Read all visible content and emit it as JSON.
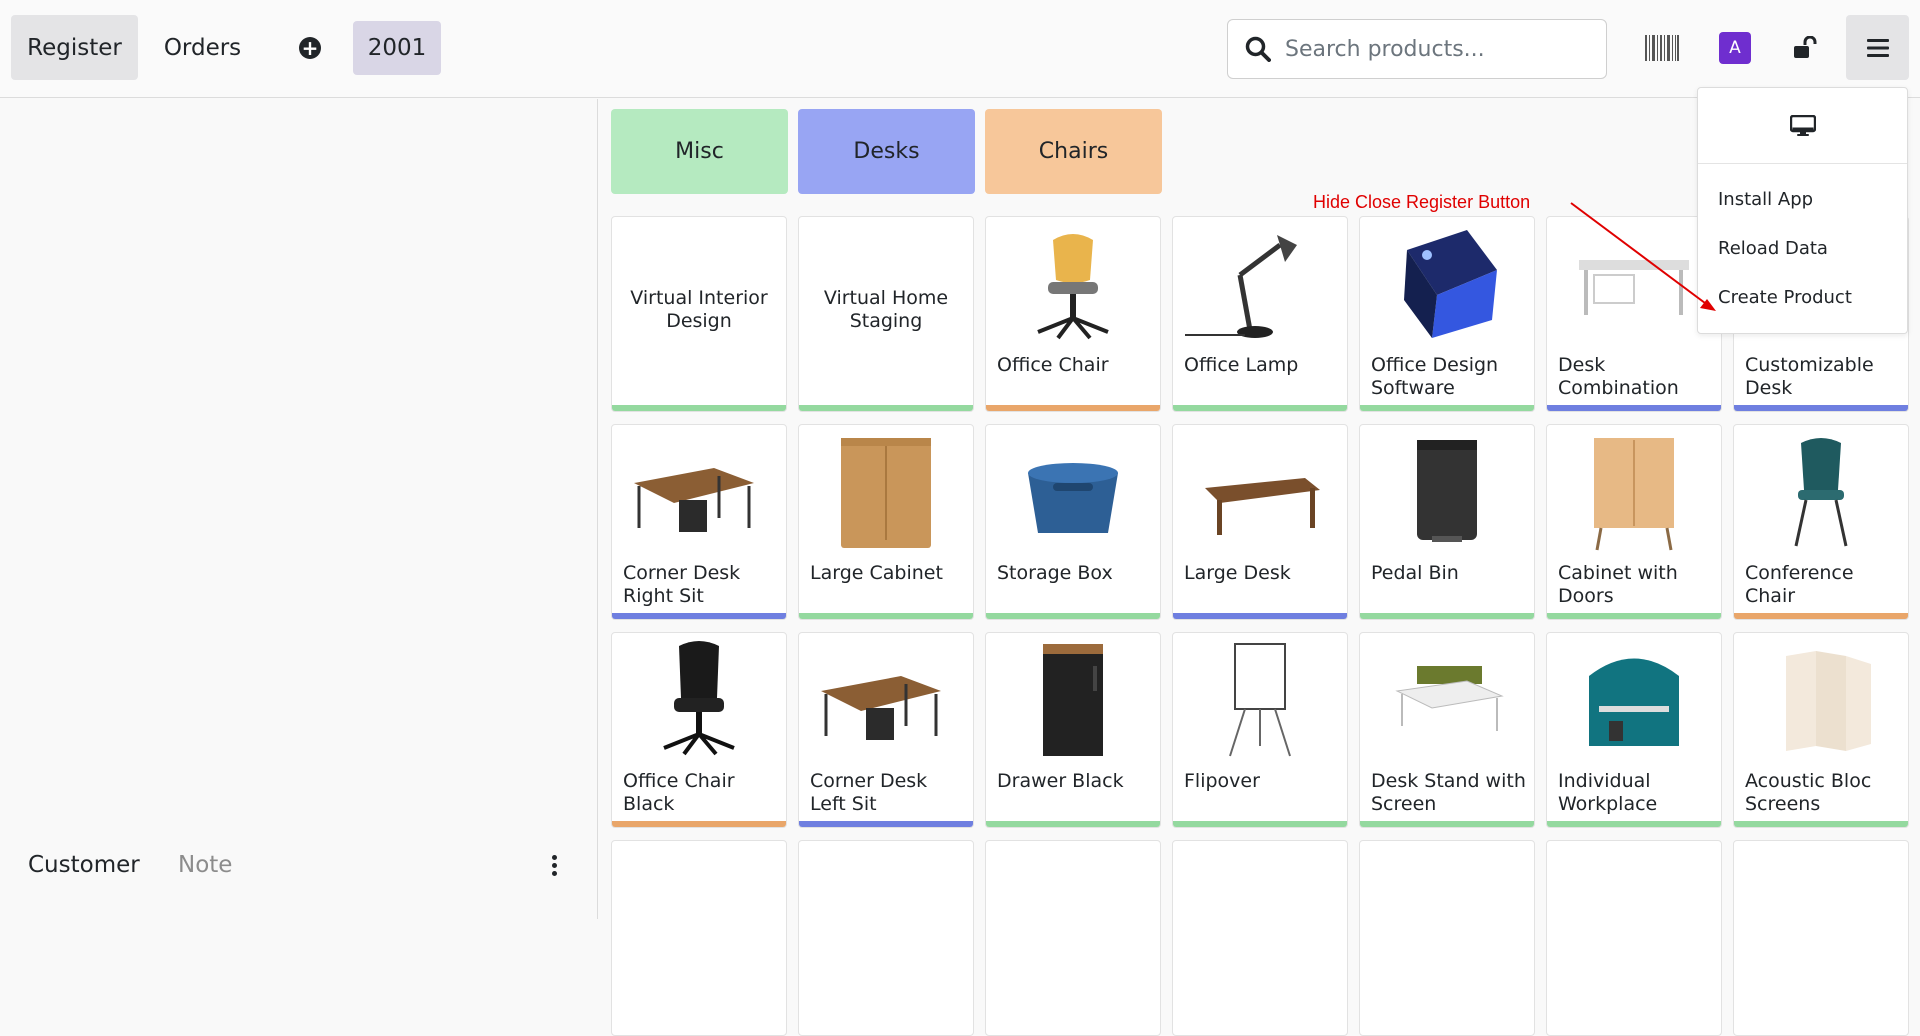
{
  "header": {
    "register_label": "Register",
    "orders_label": "Orders",
    "order_number": "2001",
    "search_placeholder": "Search products...",
    "avatar_letter": "A",
    "icons": {
      "plus": "plus-circle-icon",
      "search": "search-icon",
      "barcode": "barcode-icon",
      "lock": "unlock-icon",
      "menu": "hamburger-icon"
    }
  },
  "left_panel": {
    "customer_label": "Customer",
    "note_label": "Note"
  },
  "categories": [
    {
      "label": "Misc",
      "color": "#b5eac0"
    },
    {
      "label": "Desks",
      "color": "#98a5f3"
    },
    {
      "label": "Chairs",
      "color": "#f7c79a"
    }
  ],
  "products": [
    {
      "name": "Virtual Interior Design",
      "category": "Misc",
      "image": "none"
    },
    {
      "name": "Virtual Home Staging",
      "category": "Misc",
      "image": "none"
    },
    {
      "name": "Office Chair",
      "category": "Chairs",
      "image": "office-chair"
    },
    {
      "name": "Office Lamp",
      "category": "Misc",
      "image": "lamp"
    },
    {
      "name": "Office Design Software",
      "category": "Misc",
      "image": "software-box"
    },
    {
      "name": "Desk Combination",
      "category": "Desks",
      "image": "desk-combination"
    },
    {
      "name": "Customizable Desk",
      "category": "Desks",
      "image": "desk"
    },
    {
      "name": "Corner Desk Right Sit",
      "category": "Desks",
      "image": "corner-desk"
    },
    {
      "name": "Large Cabinet",
      "category": "Misc",
      "image": "cabinet"
    },
    {
      "name": "Storage Box",
      "category": "Misc",
      "image": "storage-box"
    },
    {
      "name": "Large Desk",
      "category": "Desks",
      "image": "large-desk"
    },
    {
      "name": "Pedal Bin",
      "category": "Misc",
      "image": "pedal-bin"
    },
    {
      "name": "Cabinet with Doors",
      "category": "Misc",
      "image": "cabinet-doors"
    },
    {
      "name": "Conference Chair",
      "category": "Chairs",
      "image": "conference-chair"
    },
    {
      "name": "Office Chair Black",
      "category": "Chairs",
      "image": "chair-black"
    },
    {
      "name": "Corner Desk Left Sit",
      "category": "Desks",
      "image": "corner-desk"
    },
    {
      "name": "Drawer Black",
      "category": "Misc",
      "image": "drawer"
    },
    {
      "name": "Flipover",
      "category": "Misc",
      "image": "flipover"
    },
    {
      "name": "Desk Stand with Screen",
      "category": "Misc",
      "image": "desk-stand"
    },
    {
      "name": "Individual Workplace",
      "category": "Misc",
      "image": "workplace"
    },
    {
      "name": "Acoustic Bloc Screens",
      "category": "Misc",
      "image": "screens"
    }
  ],
  "category_bar_colors": {
    "Misc": "#94d99f",
    "Desks": "#6f7fe0",
    "Chairs": "#e9a66a"
  },
  "dropdown_menu": {
    "icon": "monitor-icon",
    "items": [
      "Install App",
      "Reload Data",
      "Create Product"
    ]
  },
  "annotation": {
    "text": "Hide Close Register Button"
  }
}
